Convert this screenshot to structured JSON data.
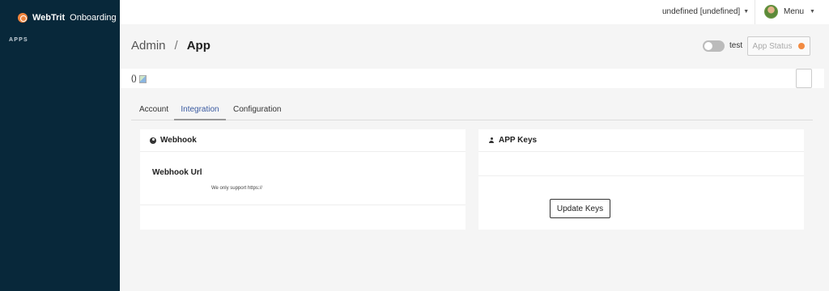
{
  "sidebar": {
    "brand_bold": "WebTrit",
    "brand_rest": "Onboarding",
    "heading": "APPS"
  },
  "topbar": {
    "user": "undefined [undefined]",
    "menu_label": "Menu"
  },
  "breadcrumb": {
    "parent": "Admin",
    "separator": "/",
    "current": "App"
  },
  "toggle": {
    "label": "test",
    "on": false
  },
  "status_button": {
    "label": "App Status",
    "dot_color": "#f28b42"
  },
  "info_strip": {
    "text": "()"
  },
  "tabs": [
    {
      "label": "Account"
    },
    {
      "label": "Integration"
    },
    {
      "label": "Configuration"
    }
  ],
  "active_tab": "Integration",
  "webhook_card": {
    "title": "Webhook",
    "field_label": "Webhook Url",
    "hint": "We only support https://"
  },
  "keys_card": {
    "title": "APP Keys",
    "button_label": "Update Keys"
  },
  "colors": {
    "sidebar_bg": "#08283a",
    "active_tab_text": "#3a5aa0",
    "brand_accent": "#f0843c"
  }
}
